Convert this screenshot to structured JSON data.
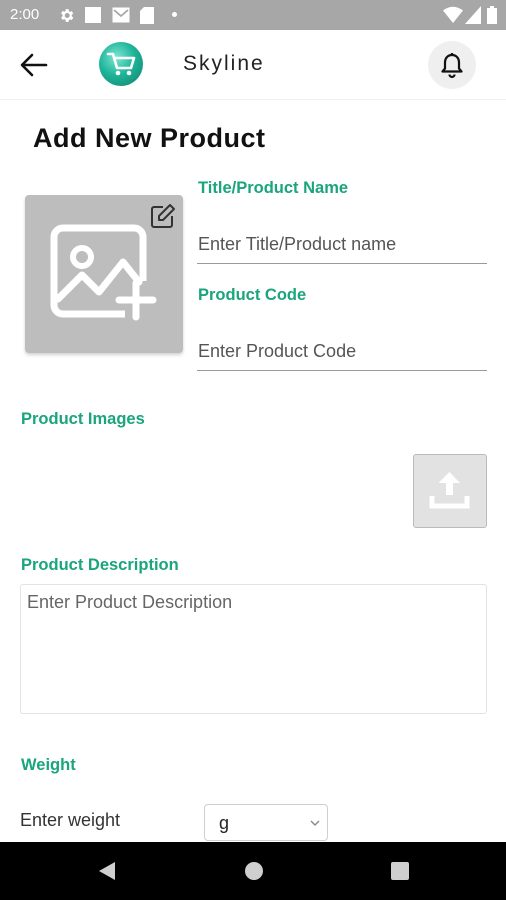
{
  "status_bar": {
    "time": "2:00",
    "icons": [
      "gear-icon",
      "square-icon",
      "mail-icon",
      "sd-card-icon",
      "dot-icon",
      "wifi-icon",
      "signal-icon",
      "battery-icon"
    ]
  },
  "app_bar": {
    "back_icon": "arrow-left-icon",
    "logo_icon": "shopping-cart-icon",
    "app_name": "Skyline",
    "notification_icon": "bell-icon"
  },
  "page": {
    "title": "Add New Product"
  },
  "form": {
    "image_picker": {
      "icon": "add-image-icon",
      "edit_icon": "edit-icon"
    },
    "title_field": {
      "label": "Title/Product Name",
      "placeholder": "Enter Title/Product name",
      "value": ""
    },
    "code_field": {
      "label": "Product Code",
      "placeholder": "Enter Product Code",
      "value": ""
    },
    "images": {
      "label": "Product Images",
      "upload_icon": "upload-icon"
    },
    "description": {
      "label": "Product Description",
      "placeholder": "Enter Product Description",
      "value": ""
    },
    "weight": {
      "label": "Weight",
      "placeholder": "Enter weight",
      "unit_selected": "g"
    }
  },
  "nav_bar": {
    "icons": [
      "back-triangle-icon",
      "home-circle-icon",
      "recents-square-icon"
    ]
  },
  "colors": {
    "accent": "#1aa57c",
    "status_bar": "#a7a7a7",
    "nav_bar": "#000000",
    "image_placeholder": "#bdbdbd"
  }
}
